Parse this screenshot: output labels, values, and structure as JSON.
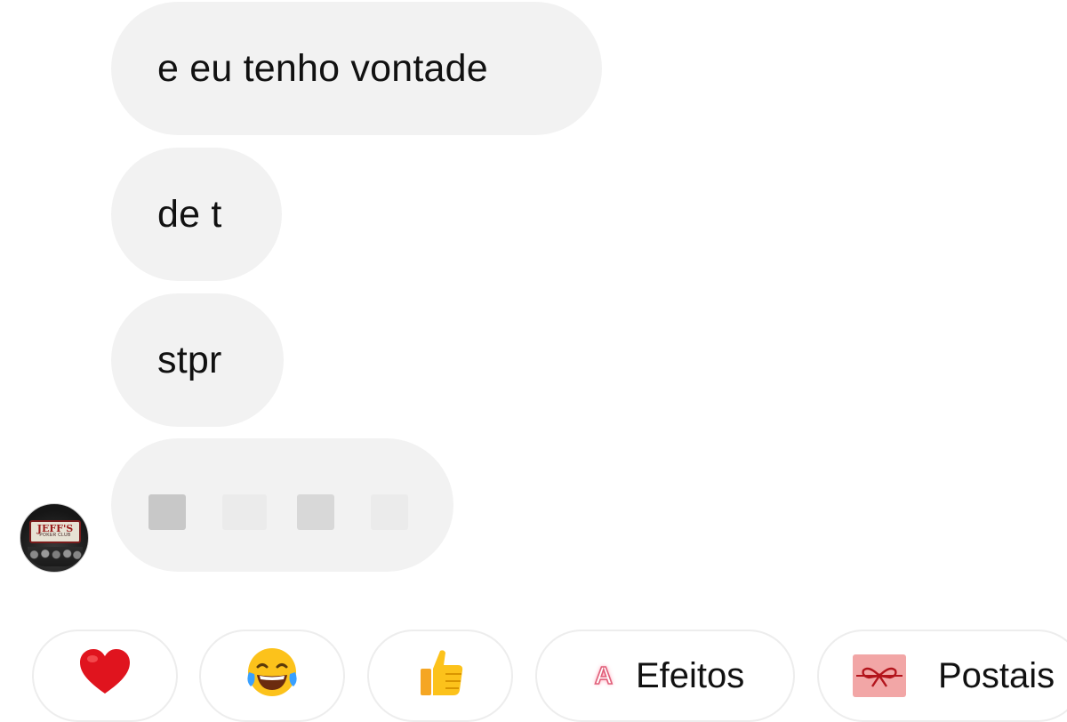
{
  "messages": [
    {
      "text": "e eu tenho vontade"
    },
    {
      "text": "de t"
    },
    {
      "text": "stpr"
    },
    {
      "text": "",
      "redacted": true
    }
  ],
  "avatar": {
    "icon": "profile-avatar",
    "sign_main": "JEFF'S",
    "sign_sub": "POKER CLUB"
  },
  "reactions": {
    "heart": {
      "icon": "heart-emoji",
      "glyph": "❤️"
    },
    "laugh": {
      "icon": "tears-of-joy-emoji",
      "glyph": "😂"
    },
    "thumbs": {
      "icon": "thumbs-up-emoji",
      "glyph": "👍"
    },
    "effects": {
      "icon": "effects-icon",
      "glyph": "A",
      "label": "Efeitos"
    },
    "cards": {
      "icon": "gift-ribbon-icon",
      "label": "Postais"
    }
  },
  "colors": {
    "bubble_bg": "#f2f2f2",
    "chip_border": "#ededed",
    "effects_accent": "#e0607a",
    "cards_bg": "#f2a6a6",
    "ribbon": "#b3151d"
  }
}
